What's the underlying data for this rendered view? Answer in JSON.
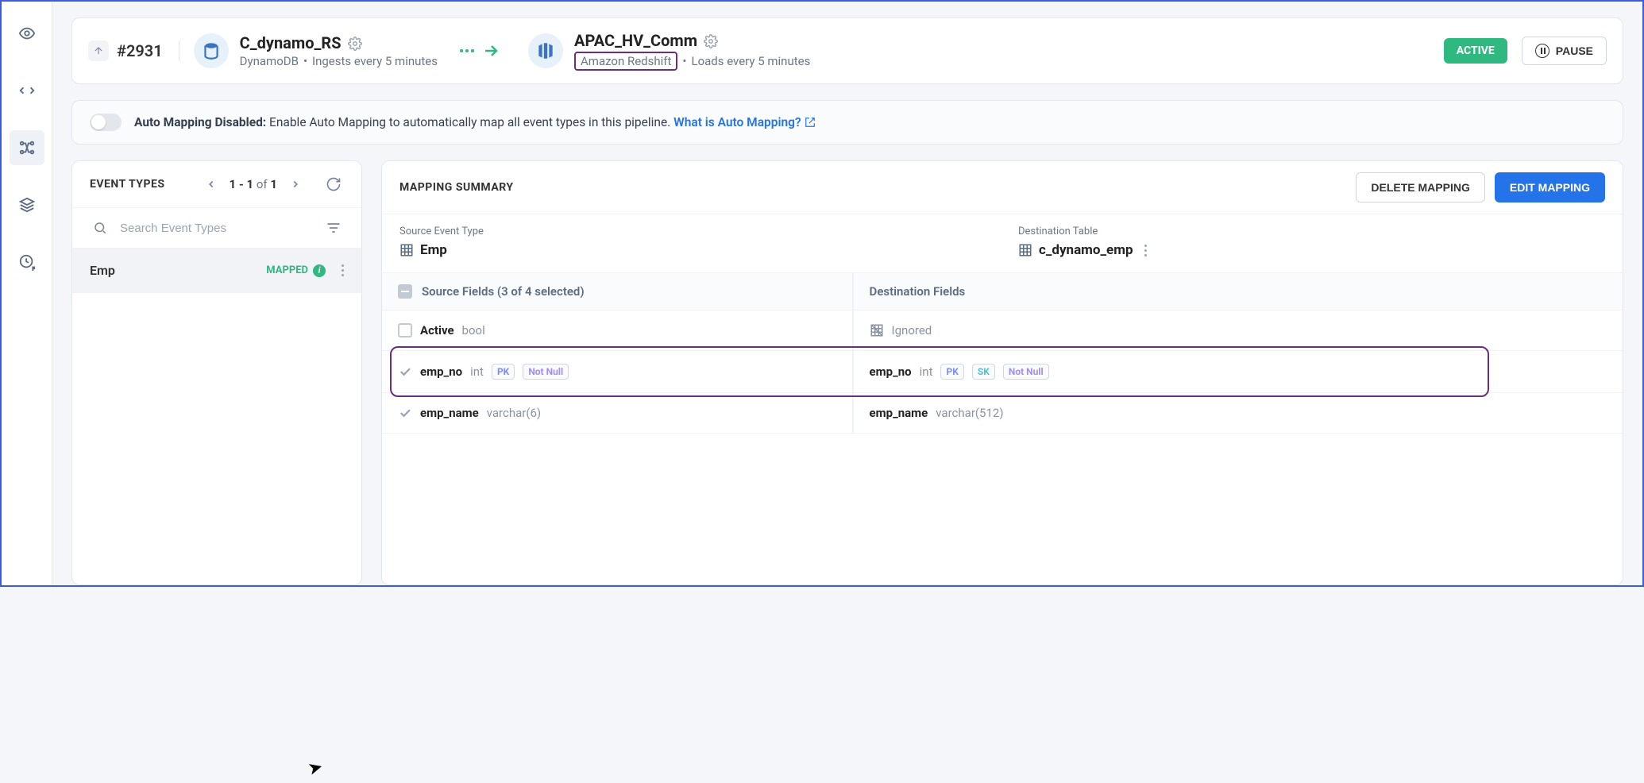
{
  "pipeline": {
    "id": "#2931"
  },
  "source": {
    "name": "C_dynamo_RS",
    "type": "DynamoDB",
    "schedule": "Ingests every 5 minutes"
  },
  "destination": {
    "name": "APAC_HV_Comm",
    "type": "Amazon Redshift",
    "schedule": "Loads every 5 minutes"
  },
  "status": {
    "active_label": "ACTIVE",
    "pause_label": "PAUSE"
  },
  "automap": {
    "title": "Auto Mapping Disabled:",
    "text": "Enable Auto Mapping to automatically map all event types in this pipeline.",
    "link": "What is Auto Mapping?"
  },
  "events_panel": {
    "title": "EVENT TYPES",
    "pager_a": "1 - 1",
    "pager_of": "of",
    "pager_b": "1",
    "search_placeholder": "Search Event Types",
    "item": {
      "name": "Emp",
      "status": "MAPPED"
    }
  },
  "mapping_panel": {
    "title": "MAPPING SUMMARY",
    "delete_btn": "DELETE MAPPING",
    "edit_btn": "EDIT MAPPING",
    "src_label": "Source Event Type",
    "src_value": "Emp",
    "dst_label": "Destination Table",
    "dst_value": "c_dynamo_emp",
    "src_header": "Source Fields (3 of 4 selected)",
    "dst_header": "Destination Fields",
    "rows": {
      "r0": {
        "src_name": "Active",
        "src_type": "bool",
        "dst_ignored": "Ignored"
      },
      "r1": {
        "src_name": "emp_no",
        "src_type": "int",
        "dst_name": "emp_no",
        "dst_type": "int"
      },
      "r2": {
        "src_name": "emp_name",
        "src_type": "varchar(6)",
        "dst_name": "emp_name",
        "dst_type": "varchar(512)"
      }
    },
    "tags": {
      "pk": "PK",
      "sk": "SK",
      "nn": "Not Null"
    }
  }
}
